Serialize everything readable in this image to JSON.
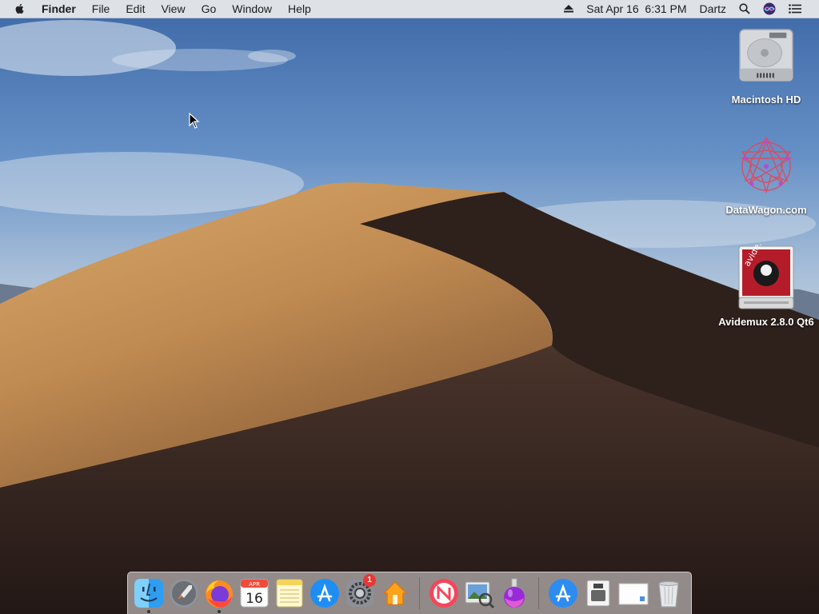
{
  "menubar": {
    "app_name": "Finder",
    "menus": [
      "File",
      "Edit",
      "View",
      "Go",
      "Window",
      "Help"
    ],
    "datetime": "Sat Apr 16  6:31 PM",
    "user": "Dartz",
    "icons": [
      "apple-icon",
      "eject-icon",
      "search-icon",
      "siri-icon",
      "notification-center-icon"
    ]
  },
  "desktop": {
    "icons": [
      {
        "label": "Macintosh HD",
        "icon": "hard-drive-icon"
      },
      {
        "label": "DataWagon.com",
        "icon": "datawagon-icon"
      },
      {
        "label": "Avidemux 2.8.0 Qt6",
        "icon": "disk-image-icon"
      }
    ]
  },
  "dock": {
    "items": [
      {
        "name": "Finder",
        "icon": "finder-icon",
        "running": true
      },
      {
        "name": "Launchpad",
        "icon": "launchpad-icon"
      },
      {
        "name": "Firefox",
        "icon": "firefox-icon",
        "running": true
      },
      {
        "name": "Calendar",
        "icon": "calendar-icon",
        "month": "APR",
        "day": "16"
      },
      {
        "name": "Notes",
        "icon": "notes-icon"
      },
      {
        "name": "App Store",
        "icon": "app-store-icon"
      },
      {
        "name": "System Preferences",
        "icon": "system-preferences-icon",
        "badge": "1"
      },
      {
        "name": "Home",
        "icon": "home-icon"
      },
      {
        "name": "News",
        "icon": "news-icon"
      },
      {
        "name": "Preview",
        "icon": "preview-icon"
      },
      {
        "name": "Potion",
        "icon": "potion-icon"
      },
      {
        "name": "App Store Downloads",
        "icon": "downloads-icon"
      },
      {
        "name": "Disk Utility",
        "icon": "disk-icon"
      },
      {
        "name": "Document",
        "icon": "document-icon"
      },
      {
        "name": "Trash",
        "icon": "trash-icon"
      }
    ]
  },
  "colors": {
    "menubar_bg": "#ececec",
    "dune_light": "#c99a5e",
    "dune_shadow": "#2b1d18",
    "sky": "#5a86c0"
  }
}
